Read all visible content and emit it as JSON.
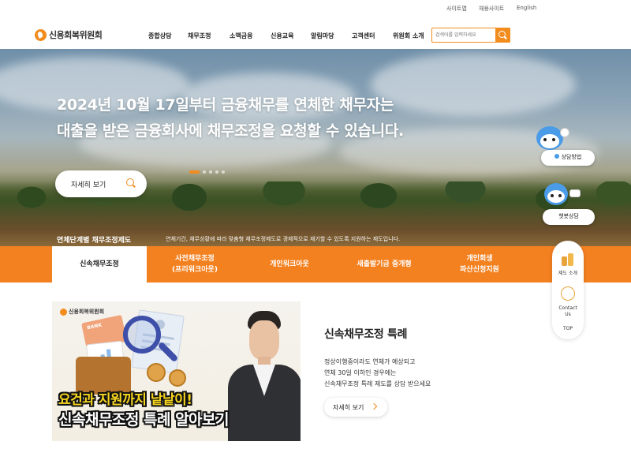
{
  "utility": {
    "sitemap": "사이트맵",
    "recruit": "채용사이트",
    "english": "English"
  },
  "header": {
    "logo_text": "신용회복위원회"
  },
  "nav": [
    "종합상담",
    "채무조정",
    "소액금융",
    "신용교육",
    "알림마당",
    "고객센터",
    "위원회 소개"
  ],
  "search": {
    "placeholder": "검색어를 입력하세요"
  },
  "hero": {
    "line1": "2024년 10월 17일부터 금융채무를 연체한 채무자는",
    "line2": "대출을 받은 금융회사에 채무조정을 요청할 수 있습니다.",
    "button": "자세히 보기"
  },
  "strip": {
    "label": "연체단계별 채무조정제도",
    "desc": "연체기간, 채무상황에 따라 맞춤형 채무조정제도로 경제적으로 재기할 수 있도록 지원하는 제도입니다."
  },
  "tabs": [
    {
      "l1": "신속채무조정",
      "l2": ""
    },
    {
      "l1": "사전채무조정",
      "l2": "(프리워크아웃)"
    },
    {
      "l1": "개인워크아웃",
      "l2": ""
    },
    {
      "l1": "새출발기금 중개형",
      "l2": ""
    },
    {
      "l1": "개인회생",
      "l2": "파산신청지원"
    }
  ],
  "thumbnail": {
    "logo": "신용회복위원회",
    "card_text": "BANK",
    "overlay1": "요건과 지원까지 낱낱이!",
    "overlay2": "신속채무조정 특례 알아보기"
  },
  "section": {
    "title": "신속채무조정 특례",
    "desc1": "정상이행중이라도 연체가 예상되고",
    "desc2": "연체 30일 이하인 경우에는",
    "desc3": "신속채무조정 특례 제도를 상담 받으세요",
    "button": "자세히 보기"
  },
  "floating": {
    "consult": "상담방법",
    "chatbot": "챗봇상담",
    "intro": "제도 소개",
    "contact1": "Contact",
    "contact2": "Us",
    "top": "TOP"
  },
  "colors": {
    "accent": "#f48120",
    "highlight_yellow": "#f6d51f"
  }
}
